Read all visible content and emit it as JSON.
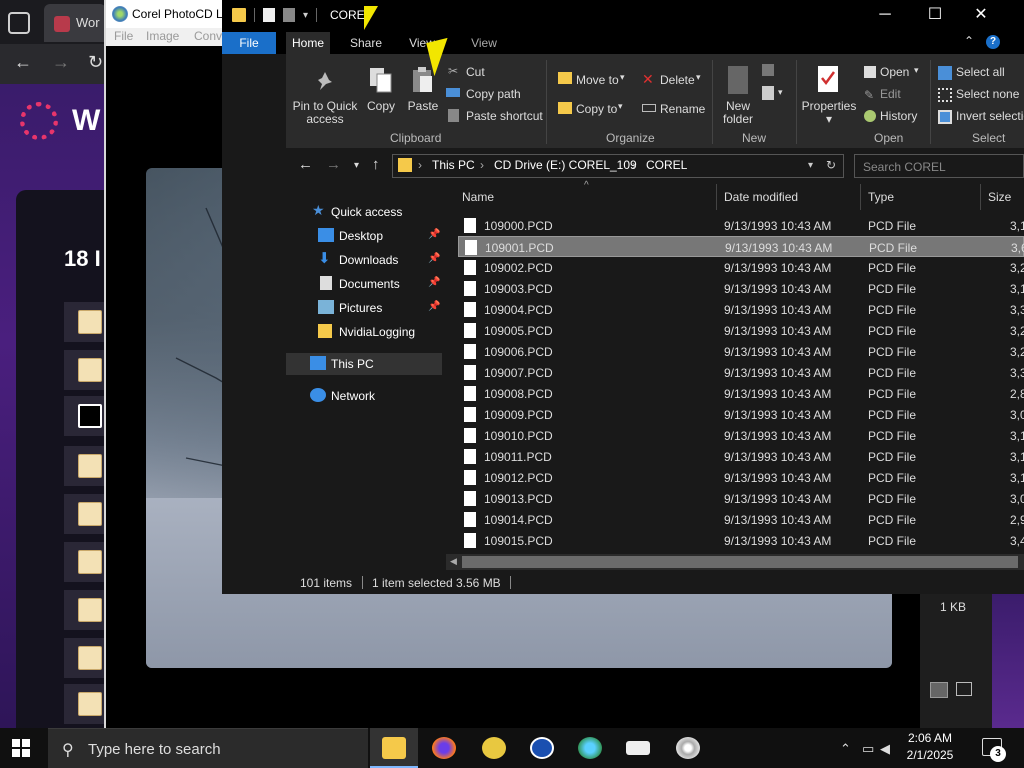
{
  "browser": {
    "tab_label": "Wor",
    "page_heading": "W",
    "section_heading": "18 I"
  },
  "corel": {
    "title": "Corel PhotoCD La",
    "menu": [
      "File",
      "Image",
      "Conv"
    ]
  },
  "explorer": {
    "title": "COREl",
    "tabs": [
      "File",
      "Home",
      "Share",
      "View",
      "View"
    ],
    "help": "?",
    "ribbon": {
      "clipboard": {
        "group": "Clipboard",
        "pin": "Pin to Quick access",
        "copy": "Copy",
        "paste": "Paste",
        "cut": "Cut",
        "copy_path": "Copy path",
        "paste_shortcut": "Paste shortcut"
      },
      "organize": {
        "group": "Organize",
        "move_to": "Move to",
        "copy_to": "Copy to",
        "delete": "Delete",
        "rename": "Rename"
      },
      "new": {
        "group": "New",
        "new_folder": "New folder"
      },
      "open": {
        "group": "Open",
        "properties": "Properties",
        "open": "Open",
        "edit": "Edit",
        "history": "History"
      },
      "select": {
        "group": "Select",
        "select_all": "Select all",
        "select_none": "Select none",
        "invert": "Invert selectio"
      }
    },
    "address": {
      "crumbs": [
        "This PC",
        "CD Drive (E:) COREL_109",
        "COREL"
      ],
      "search_placeholder": "Search COREL"
    },
    "nav": {
      "quick_access": "Quick access",
      "items": [
        "Desktop",
        "Downloads",
        "Documents",
        "Pictures",
        "NvidiaLogging"
      ],
      "this_pc": "This PC",
      "network": "Network"
    },
    "columns": [
      "Name",
      "Date modified",
      "Type",
      "Size"
    ],
    "files": [
      {
        "name": "109000.PCD",
        "date": "9/13/1993 10:43 AM",
        "type": "PCD File",
        "size": "3,1"
      },
      {
        "name": "109001.PCD",
        "date": "9/13/1993 10:43 AM",
        "type": "PCD File",
        "size": "3,6"
      },
      {
        "name": "109002.PCD",
        "date": "9/13/1993 10:43 AM",
        "type": "PCD File",
        "size": "3,2"
      },
      {
        "name": "109003.PCD",
        "date": "9/13/1993 10:43 AM",
        "type": "PCD File",
        "size": "3,1"
      },
      {
        "name": "109004.PCD",
        "date": "9/13/1993 10:43 AM",
        "type": "PCD File",
        "size": "3,3"
      },
      {
        "name": "109005.PCD",
        "date": "9/13/1993 10:43 AM",
        "type": "PCD File",
        "size": "3,2"
      },
      {
        "name": "109006.PCD",
        "date": "9/13/1993 10:43 AM",
        "type": "PCD File",
        "size": "3,2"
      },
      {
        "name": "109007.PCD",
        "date": "9/13/1993 10:43 AM",
        "type": "PCD File",
        "size": "3,3"
      },
      {
        "name": "109008.PCD",
        "date": "9/13/1993 10:43 AM",
        "type": "PCD File",
        "size": "2,8"
      },
      {
        "name": "109009.PCD",
        "date": "9/13/1993 10:43 AM",
        "type": "PCD File",
        "size": "3,0"
      },
      {
        "name": "109010.PCD",
        "date": "9/13/1993 10:43 AM",
        "type": "PCD File",
        "size": "3,1"
      },
      {
        "name": "109011.PCD",
        "date": "9/13/1993 10:43 AM",
        "type": "PCD File",
        "size": "3,1"
      },
      {
        "name": "109012.PCD",
        "date": "9/13/1993 10:43 AM",
        "type": "PCD File",
        "size": "3,1"
      },
      {
        "name": "109013.PCD",
        "date": "9/13/1993 10:43 AM",
        "type": "PCD File",
        "size": "3,0"
      },
      {
        "name": "109014.PCD",
        "date": "9/13/1993 10:43 AM",
        "type": "PCD File",
        "size": "2,9"
      },
      {
        "name": "109015.PCD",
        "date": "9/13/1993 10:43 AM",
        "type": "PCD File",
        "size": "3,4"
      }
    ],
    "selected_index": 1,
    "status": {
      "items": "101 items",
      "selected": "1 item selected",
      "size": "3.56 MB"
    }
  },
  "right_panel": {
    "size_text": "1 KB"
  },
  "taskbar": {
    "search_placeholder": "Type here to search",
    "time": "2:06 AM",
    "date": "2/1/2025",
    "notification_count": "3"
  },
  "colors": {
    "accent": "#1a6fc9",
    "folder": "#f5c94a",
    "cursor": "#f2e600"
  }
}
